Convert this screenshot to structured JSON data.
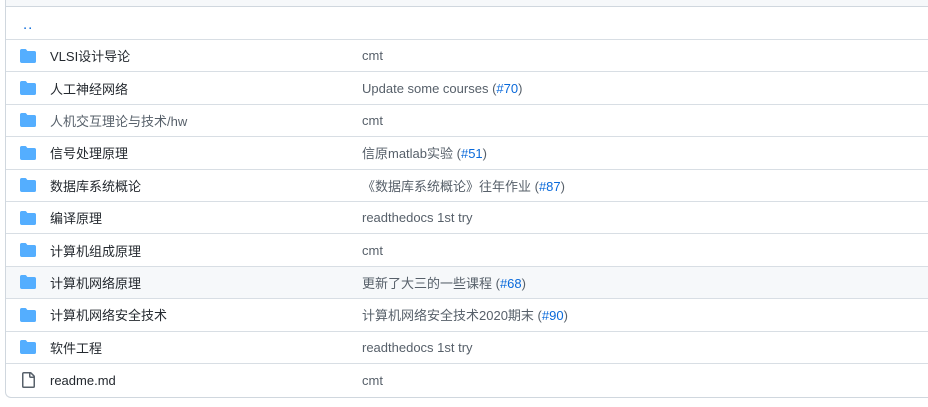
{
  "parent_link": "..",
  "rows": [
    {
      "type": "folder",
      "icon": "folder-icon",
      "name": "VLSI设计导论",
      "message": "cmt",
      "pr": ""
    },
    {
      "type": "folder",
      "icon": "folder-icon",
      "name": "人工神经网络",
      "message": "Update some courses (",
      "pr": "#70",
      "suffix": ")"
    },
    {
      "type": "folder",
      "icon": "folder-icon",
      "name": "人机交互理论与技术/hw",
      "message": "cmt",
      "pr": ""
    },
    {
      "type": "folder",
      "icon": "folder-icon",
      "name": "信号处理原理",
      "message": "信原matlab实验 (",
      "pr": "#51",
      "suffix": ")"
    },
    {
      "type": "folder",
      "icon": "folder-icon",
      "name": "数据库系统概论",
      "message": "《数据库系统概论》往年作业 (",
      "pr": "#87",
      "suffix": ")"
    },
    {
      "type": "folder",
      "icon": "folder-icon",
      "name": "编译原理",
      "message": "readthedocs 1st try",
      "pr": ""
    },
    {
      "type": "folder",
      "icon": "folder-icon",
      "name": "计算机组成原理",
      "message": "cmt",
      "pr": ""
    },
    {
      "type": "folder",
      "icon": "folder-icon",
      "name": "计算机网络原理",
      "message": "更新了大三的一些课程 (",
      "pr": "#68",
      "suffix": ")"
    },
    {
      "type": "folder",
      "icon": "folder-icon",
      "name": "计算机网络安全技术",
      "message": "计算机网络安全技术2020期末 (",
      "pr": "#90",
      "suffix": ")"
    },
    {
      "type": "folder",
      "icon": "folder-icon",
      "name": "软件工程",
      "message": "readthedocs 1st try",
      "pr": ""
    },
    {
      "type": "file",
      "icon": "file-icon",
      "name": "readme.md",
      "message": "cmt",
      "pr": ""
    }
  ],
  "colors": {
    "folder": "#54aeff",
    "link": "#0969da",
    "border": "#d0d7de",
    "hover_row": "#f6f8fa"
  }
}
